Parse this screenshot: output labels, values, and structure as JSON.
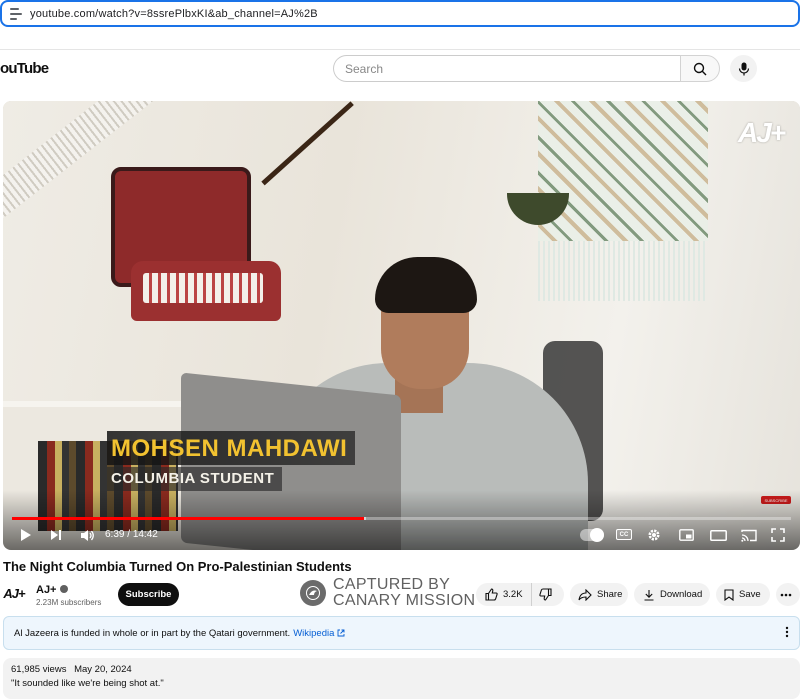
{
  "browser": {
    "url": "youtube.com/watch?v=8ssrePlbxKI&ab_channel=AJ%2B"
  },
  "header": {
    "logo_text": "ouTube",
    "search_placeholder": "Search",
    "search_icon": "search-icon",
    "mic_icon": "mic-icon"
  },
  "player": {
    "watermark": "AJ+",
    "lower_third": {
      "name": "MOHSEN MAHDAWI",
      "role": "COLUMBIA STUDENT"
    },
    "subscribe_watermark": "SUBSCRIBE",
    "current_time": "6:39",
    "duration": "14:42",
    "time_separator": "/",
    "progress_fraction": 0.452,
    "buffer_fraction": 0.455,
    "cc_label": "CC",
    "accent_color": "#ff0000"
  },
  "video": {
    "title": "The Night Columbia Turned On Pro-Palestinian Students"
  },
  "channel": {
    "avatar_text": "AJ+",
    "name": "AJ+",
    "subscribers": "2.23M subscribers",
    "subscribe_label": "Subscribe"
  },
  "overlay_stamp": {
    "line1": "CAPTURED BY",
    "line2": "CANARY MISSION"
  },
  "actions": {
    "likes": "3.2K",
    "share_label": "Share",
    "download_label": "Download",
    "save_label": "Save"
  },
  "info_panel": {
    "text": "Al Jazeera is funded in whole or in part by the Qatari government.",
    "link_label": "Wikipedia"
  },
  "description": {
    "views": "61,985 views",
    "date": "May 20, 2024",
    "snippet": "\"It sounded like we're being shot at.\""
  }
}
